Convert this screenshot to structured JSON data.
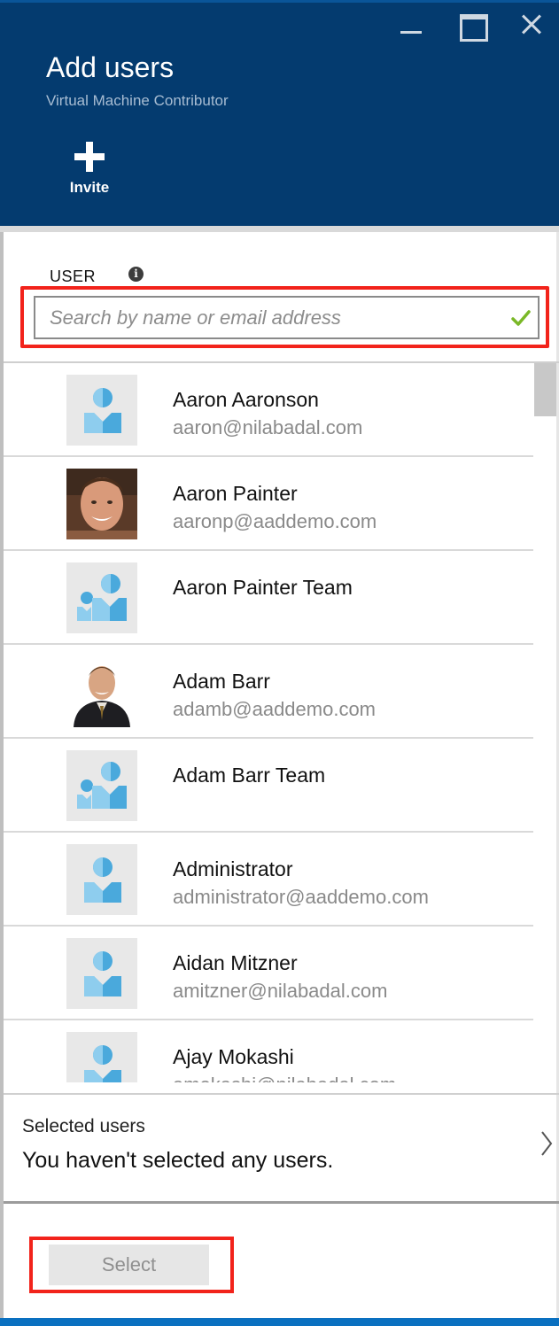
{
  "header": {
    "title": "Add users",
    "subtitle": "Virtual Machine Contributor",
    "invite_label": "Invite"
  },
  "search": {
    "label": "USER",
    "placeholder": "Search by name or email address"
  },
  "users": [
    {
      "name": "Aaron Aaronson",
      "email": "aaron@nilabadal.com",
      "avatar": "person-icon"
    },
    {
      "name": "Aaron Painter",
      "email": "aaronp@aaddemo.com",
      "avatar": "photo"
    },
    {
      "name": "Aaron Painter Team",
      "email": "",
      "avatar": "group-icon"
    },
    {
      "name": "Adam Barr",
      "email": "adamb@aaddemo.com",
      "avatar": "photo"
    },
    {
      "name": "Adam Barr Team",
      "email": "",
      "avatar": "group-icon"
    },
    {
      "name": "Administrator",
      "email": "administrator@aaddemo.com",
      "avatar": "person-icon"
    },
    {
      "name": "Aidan Mitzner",
      "email": "amitzner@nilabadal.com",
      "avatar": "person-icon"
    },
    {
      "name": "Ajay Mokashi",
      "email": "amokashi@nilabadal.com",
      "avatar": "person-icon"
    }
  ],
  "selected": {
    "title": "Selected users",
    "value": "You haven't selected any users."
  },
  "actions": {
    "select_label": "Select"
  },
  "colors": {
    "header_bg": "#043b6f",
    "highlight": "#f2231b",
    "icon_blue": "#4aa9dc",
    "check_green": "#7ab827"
  }
}
